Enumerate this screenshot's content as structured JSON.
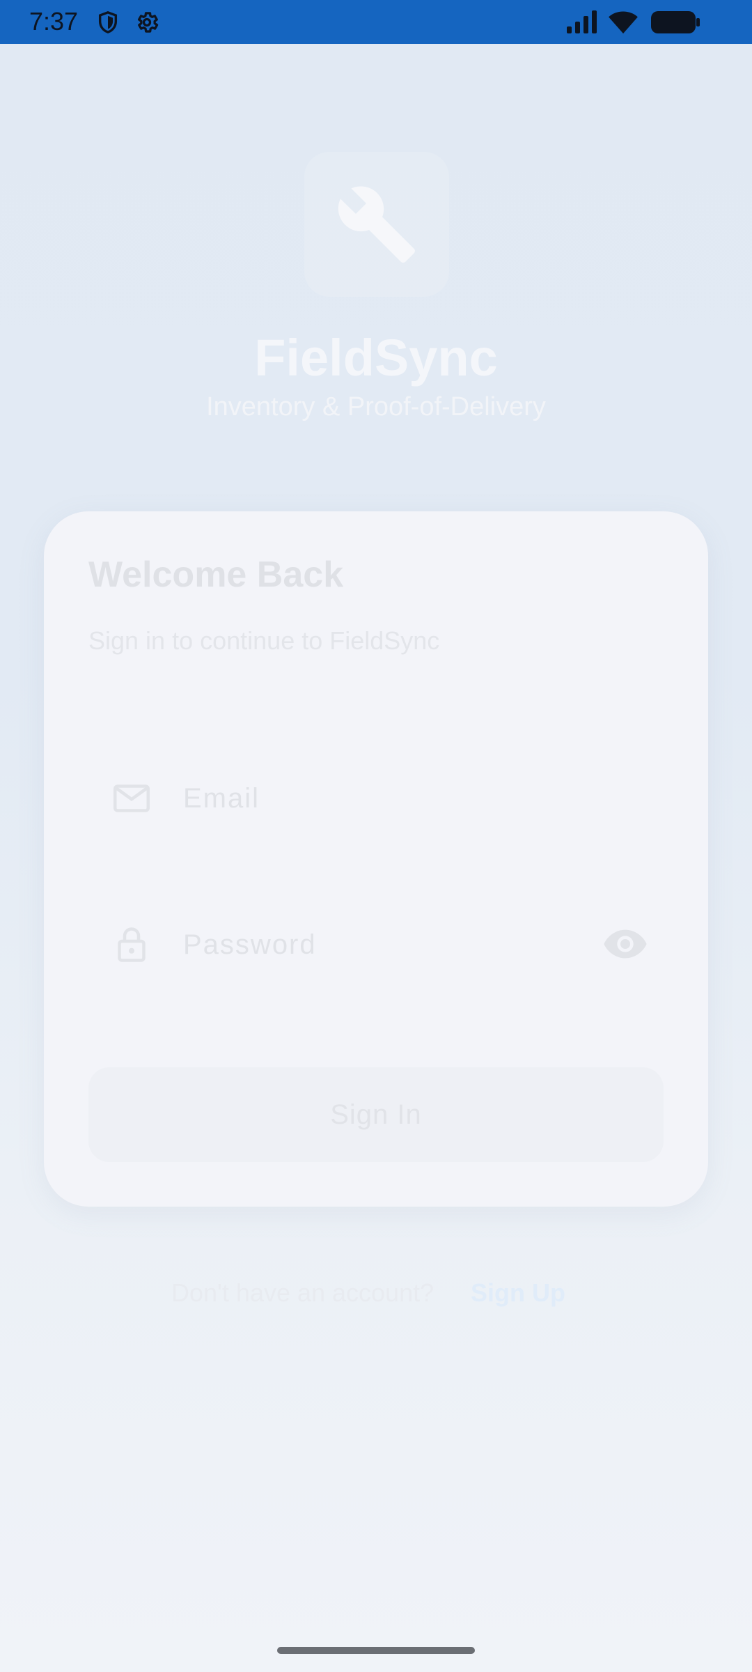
{
  "status_bar": {
    "time": "7:37",
    "icons": [
      "shield-icon",
      "gear-icon",
      "signal-icon",
      "wifi-icon",
      "battery-icon"
    ],
    "background": "#1565c0"
  },
  "header": {
    "logo_icon": "wrench-icon",
    "title": "FieldSync",
    "subtitle": "Inventory & Proof-of-Delivery"
  },
  "login_card": {
    "title": "Welcome Back",
    "subtitle": "Sign in to continue to FieldSync",
    "email": {
      "placeholder": "Email",
      "value": "",
      "icon": "mail-icon"
    },
    "password": {
      "placeholder": "Password",
      "value": "",
      "icon": "lock-icon",
      "toggle_icon": "eye-icon"
    },
    "sign_in_label": "Sign In"
  },
  "footer": {
    "prompt": "Don't have an account?",
    "sign_up_label": "Sign Up"
  },
  "colors": {
    "accent": "#1565c0",
    "background": "#e2eaf4",
    "card": "#f3f4f9"
  }
}
